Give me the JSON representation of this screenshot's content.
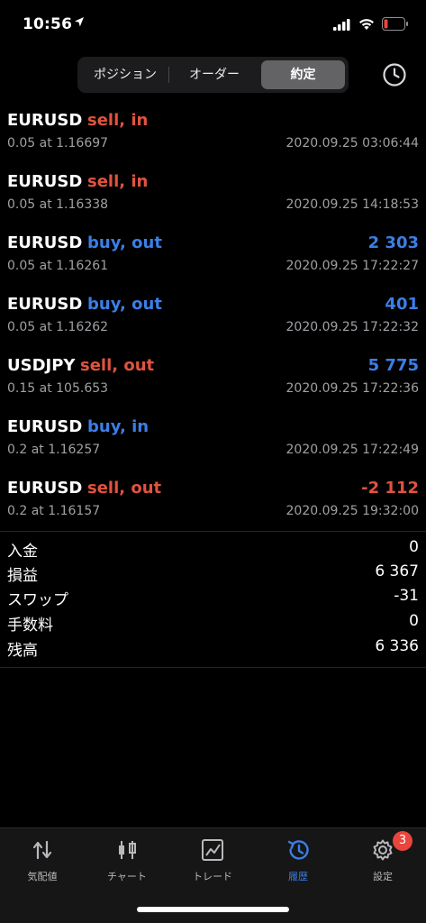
{
  "status_bar": {
    "time": "10:56"
  },
  "segmented": {
    "items": [
      "ポジション",
      "オーダー",
      "約定"
    ],
    "selected": "約定"
  },
  "colors": {
    "sell": "#e0533f",
    "buy": "#3b7fe6",
    "loss": "#e0533f",
    "profit": "#3b7fe6",
    "accent": "#3b7fe6"
  },
  "deals": [
    {
      "symbol": "EURUSD",
      "action": "sell, in",
      "side": "sell",
      "volume_price": "0.05 at 1.16697",
      "time": "2020.09.25 03:06:44",
      "profit": ""
    },
    {
      "symbol": "EURUSD",
      "action": "sell, in",
      "side": "sell",
      "volume_price": "0.05 at 1.16338",
      "time": "2020.09.25 14:18:53",
      "profit": ""
    },
    {
      "symbol": "EURUSD",
      "action": "buy, out",
      "side": "buy",
      "volume_price": "0.05 at 1.16261",
      "time": "2020.09.25 17:22:27",
      "profit": "2 303"
    },
    {
      "symbol": "EURUSD",
      "action": "buy, out",
      "side": "buy",
      "volume_price": "0.05 at 1.16262",
      "time": "2020.09.25 17:22:32",
      "profit": "401"
    },
    {
      "symbol": "USDJPY",
      "action": "sell, out",
      "side": "sell",
      "volume_price": "0.15 at 105.653",
      "time": "2020.09.25 17:22:36",
      "profit": "5 775"
    },
    {
      "symbol": "EURUSD",
      "action": "buy, in",
      "side": "buy",
      "volume_price": "0.2 at 1.16257",
      "time": "2020.09.25 17:22:49",
      "profit": ""
    },
    {
      "symbol": "EURUSD",
      "action": "sell, out",
      "side": "sell",
      "volume_price": "0.2 at 1.16157",
      "time": "2020.09.25 19:32:00",
      "profit": "-2 112"
    }
  ],
  "summary": [
    {
      "label": "入金",
      "value": "0"
    },
    {
      "label": "損益",
      "value": "6 367"
    },
    {
      "label": "スワップ",
      "value": "-31"
    },
    {
      "label": "手数料",
      "value": "0"
    },
    {
      "label": "残高",
      "value": "6 336"
    }
  ],
  "tabs": [
    {
      "label": "気配値",
      "icon": "quotes-arrows-icon",
      "active": false
    },
    {
      "label": "チャート",
      "icon": "candlestick-chart-icon",
      "active": false
    },
    {
      "label": "トレード",
      "icon": "trade-chart-icon",
      "active": false
    },
    {
      "label": "履歴",
      "icon": "history-clock-icon",
      "active": true
    },
    {
      "label": "設定",
      "icon": "settings-gear-icon",
      "active": false
    }
  ],
  "settings_badge": "3"
}
